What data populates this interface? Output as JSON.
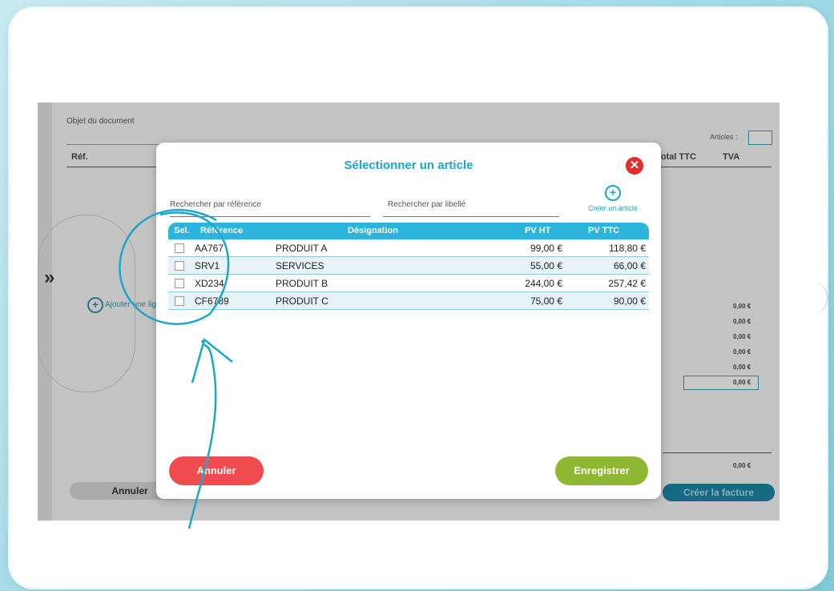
{
  "background": {
    "objet_label": "Objet du document",
    "articles_label": "Articles :",
    "col_ref": "Réf.",
    "col_total_ttc": "Total TTC",
    "col_tva": "TVA",
    "add_line_label": "Ajouter une ligne",
    "totals": [
      "0,00 €",
      "0,00 €",
      "0,00 €",
      "0,00 €",
      "0,00 €",
      "0,00 €"
    ],
    "grand_total": "0,00 €",
    "annuler": "Annuler",
    "creer_facture": "Créer la facture",
    "expand_icon": "double-chevron-right-icon"
  },
  "modal": {
    "title": "Sélectionner un article",
    "search_reference_placeholder": "Rechercher par référence",
    "search_libelle_placeholder": "Rechercher par libellé",
    "create_article": "Créer un article",
    "headers": {
      "sel": "Sel.",
      "reference": "Référence",
      "designation": "Désignation",
      "pv_ht": "PV HT",
      "pv_ttc": "PV TTC"
    },
    "rows": [
      {
        "reference": "AA767",
        "designation": "PRODUIT A",
        "pv_ht": "99,00 €",
        "pv_ttc": "118,80 €"
      },
      {
        "reference": "SRV1",
        "designation": "SERVICES",
        "pv_ht": "55,00 €",
        "pv_ttc": "66,00 €"
      },
      {
        "reference": "XD234",
        "designation": "PRODUIT B",
        "pv_ht": "244,00 €",
        "pv_ttc": "257,42 €"
      },
      {
        "reference": "CF6789",
        "designation": "PRODUIT C",
        "pv_ht": "75,00 €",
        "pv_ttc": "90,00 €"
      }
    ],
    "cancel_button": "Annuler",
    "save_button": "Enregistrer"
  },
  "colors": {
    "accent": "#1ca6c9",
    "header_bar": "#2bb5da",
    "danger": "#f04b4f",
    "success": "#8fb832",
    "close": "#e32d2d"
  }
}
